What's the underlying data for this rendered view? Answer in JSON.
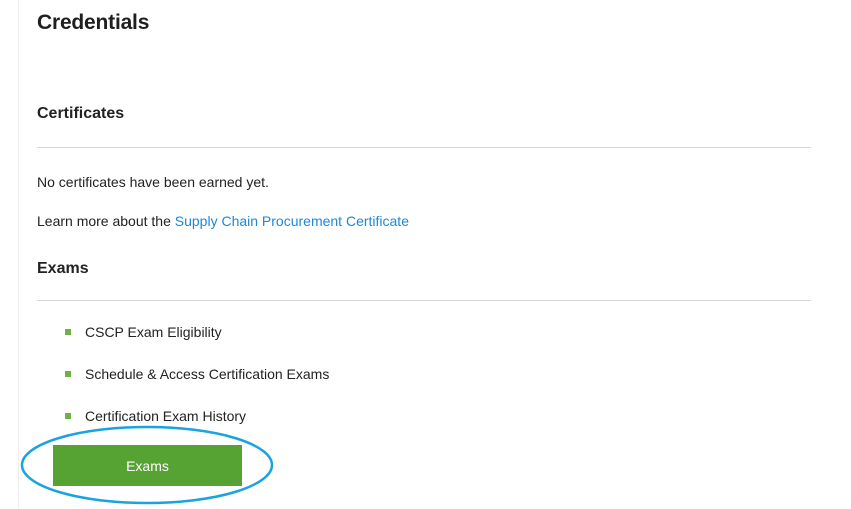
{
  "page": {
    "title": "Credentials"
  },
  "certificates": {
    "heading": "Certificates",
    "empty_message": "No certificates have been earned yet.",
    "learn_more_prefix": "Learn more about the ",
    "learn_more_link": "Supply Chain Procurement Certificate"
  },
  "exams": {
    "heading": "Exams",
    "items": [
      {
        "label": "CSCP Exam Eligibility"
      },
      {
        "label": "Schedule & Access Certification Exams"
      },
      {
        "label": "Certification Exam History"
      }
    ],
    "button_label": "Exams"
  },
  "colors": {
    "accent_green": "#56a334",
    "link_blue": "#1e88d8",
    "highlight_ring": "#1aa3e0"
  }
}
